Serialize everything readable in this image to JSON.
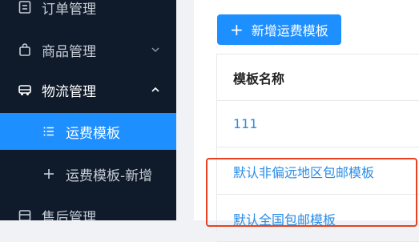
{
  "sidebar": {
    "items": [
      {
        "label": "订单管理",
        "icon": "order-icon"
      },
      {
        "label": "商品管理",
        "icon": "bag-icon",
        "chevron": "chevron-down-icon"
      },
      {
        "label": "物流管理",
        "icon": "truck-icon",
        "chevron": "chevron-up-icon"
      },
      {
        "label": "运费模板",
        "icon": "list-icon",
        "active": true
      },
      {
        "label": "运费模板-新增",
        "icon": "plus-icon"
      },
      {
        "label": "售后管理",
        "icon": "service-icon"
      }
    ]
  },
  "main": {
    "add_button_label": "新增运费模板",
    "table": {
      "header": "模板名称",
      "rows": [
        "111",
        "默认非偏远地区包邮模板",
        "默认全国包邮模板"
      ]
    }
  },
  "colors": {
    "sidebar_bg": "#0f1a2a",
    "accent": "#1e8fff",
    "link": "#2a8de8",
    "highlight_border": "#e8431e"
  }
}
